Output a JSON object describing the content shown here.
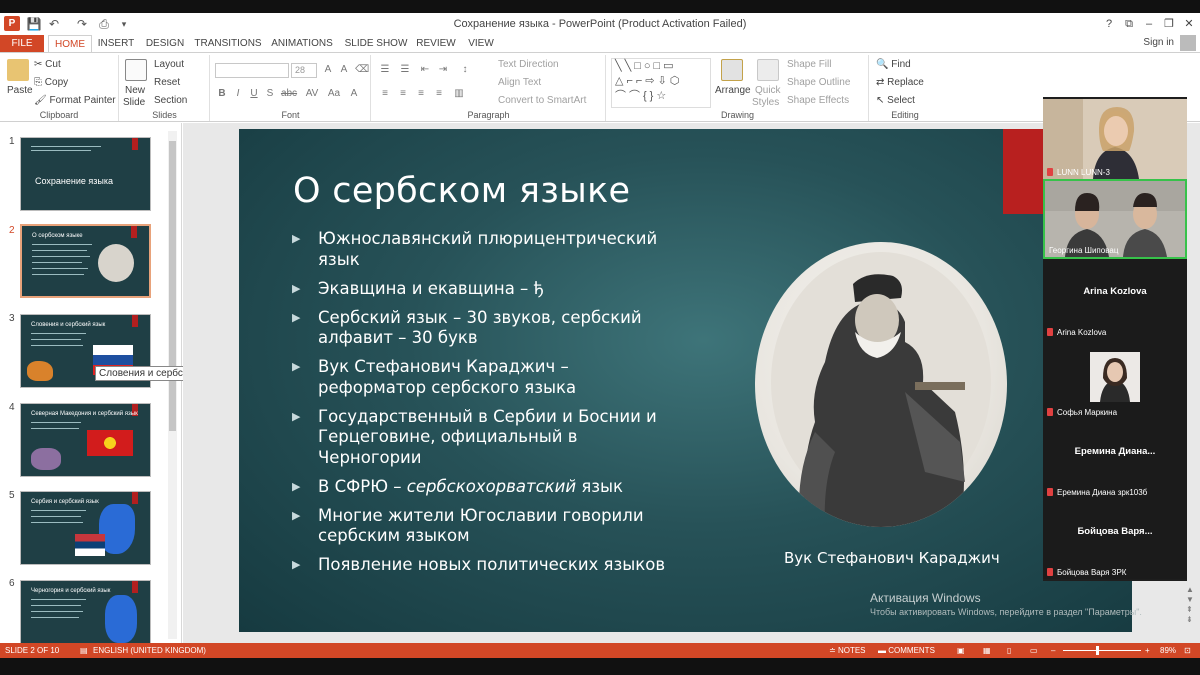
{
  "window": {
    "title": "Сохранение языка - PowerPoint (Product Activation Failed)",
    "help": "?",
    "controls": [
      "⧉",
      "–",
      "❐",
      "✕"
    ]
  },
  "quick_access": [
    "💾",
    "↶",
    "↷",
    "⎙"
  ],
  "tabs": [
    "FILE",
    "HOME",
    "INSERT",
    "DESIGN",
    "TRANSITIONS",
    "ANIMATIONS",
    "SLIDE SHOW",
    "REVIEW",
    "VIEW"
  ],
  "signin": "Sign in",
  "ribbon": {
    "clipboard": {
      "paste": "Paste",
      "cut": "Cut",
      "copy": "Copy",
      "format_painter": "Format Painter",
      "label": "Clipboard"
    },
    "slides": {
      "new_slide": "New",
      "new_slide2": "Slide",
      "layout": "Layout",
      "reset": "Reset",
      "section": "Section",
      "label": "Slides"
    },
    "font": {
      "size": "28",
      "label": "Font",
      "buttons": [
        "B",
        "I",
        "U",
        "S",
        "abc",
        "AV",
        "Aa",
        "A"
      ]
    },
    "paragraph": {
      "text_direction": "Text Direction",
      "align_text": "Align Text",
      "convert": "Convert to SmartArt",
      "label": "Paragraph"
    },
    "drawing": {
      "arrange": "Arrange",
      "quick_styles": "Quick",
      "quick_styles2": "Styles",
      "shape_fill": "Shape Fill",
      "shape_outline": "Shape Outline",
      "shape_effects": "Shape Effects",
      "label": "Drawing"
    },
    "editing": {
      "find": "Find",
      "replace": "Replace",
      "select": "Select",
      "label": "Editing"
    }
  },
  "thumbnails": [
    {
      "num": "1",
      "title": "Сохранение языка",
      "selected": false
    },
    {
      "num": "2",
      "title": "О сербском языке",
      "selected": true
    },
    {
      "num": "3",
      "title": "Словения и сербский язык",
      "selected": false
    },
    {
      "num": "4",
      "title": "Северная Македония и сербский язык",
      "selected": false
    },
    {
      "num": "5",
      "title": "Сербия и сербский язык",
      "selected": false
    },
    {
      "num": "6",
      "title": "Черногория и сербский язык",
      "selected": false
    }
  ],
  "tooltip": "Словения и сербский язык",
  "slide": {
    "title": "О сербском языке",
    "bullets": [
      {
        "text": "Южнославянский плюрицентрический язык"
      },
      {
        "text": "Экавщина и екавщина – ђ"
      },
      {
        "text": "Сербский язык – 30 звуков, сербский алфавит – 30 букв"
      },
      {
        "text": "Вук Стефанович Караджич – реформатор сербского языка"
      },
      {
        "text": "Государственный в Сербии и Боснии и Герцеговине, официальный в Черногории"
      },
      {
        "pre": "В СФРЮ – ",
        "em": "сербскохорватский",
        "post": " язык"
      },
      {
        "text": "Многие жители Югославии говорили сербским языком"
      },
      {
        "text": "Появление новых политических языков"
      }
    ],
    "caption": "Вук Стефанович Караджич"
  },
  "activation": {
    "line1": "Активация Windows",
    "line2": "Чтобы активировать Windows, перейдите в раздел \"Параметры\"."
  },
  "participants": [
    {
      "name": "LUNN LUNN-3",
      "type": "video"
    },
    {
      "name": "Георгина Шиповац",
      "type": "video"
    },
    {
      "name": "Arina Kozlova",
      "display": "Arina Kozlova",
      "type": "name"
    },
    {
      "name": "Софья Маркина",
      "type": "photo"
    },
    {
      "name": "Еремина Диана зрк103б",
      "display": "Еремина  Диана...",
      "type": "name"
    },
    {
      "name": "Бойцова Варя ЗРК",
      "display": "Бойцова  Варя...",
      "type": "name"
    }
  ],
  "status": {
    "slide": "SLIDE 2 OF 10",
    "language": "ENGLISH (UNITED KINGDOM)",
    "notes": "NOTES",
    "comments": "COMMENTS",
    "zoom": "89%",
    "zoom_minus": "–",
    "zoom_plus": "+"
  },
  "colors": {
    "accent": "#d24726",
    "slide_bg": "#275258",
    "slide_bar": "#b8201f",
    "active_speaker": "#37c24a"
  }
}
